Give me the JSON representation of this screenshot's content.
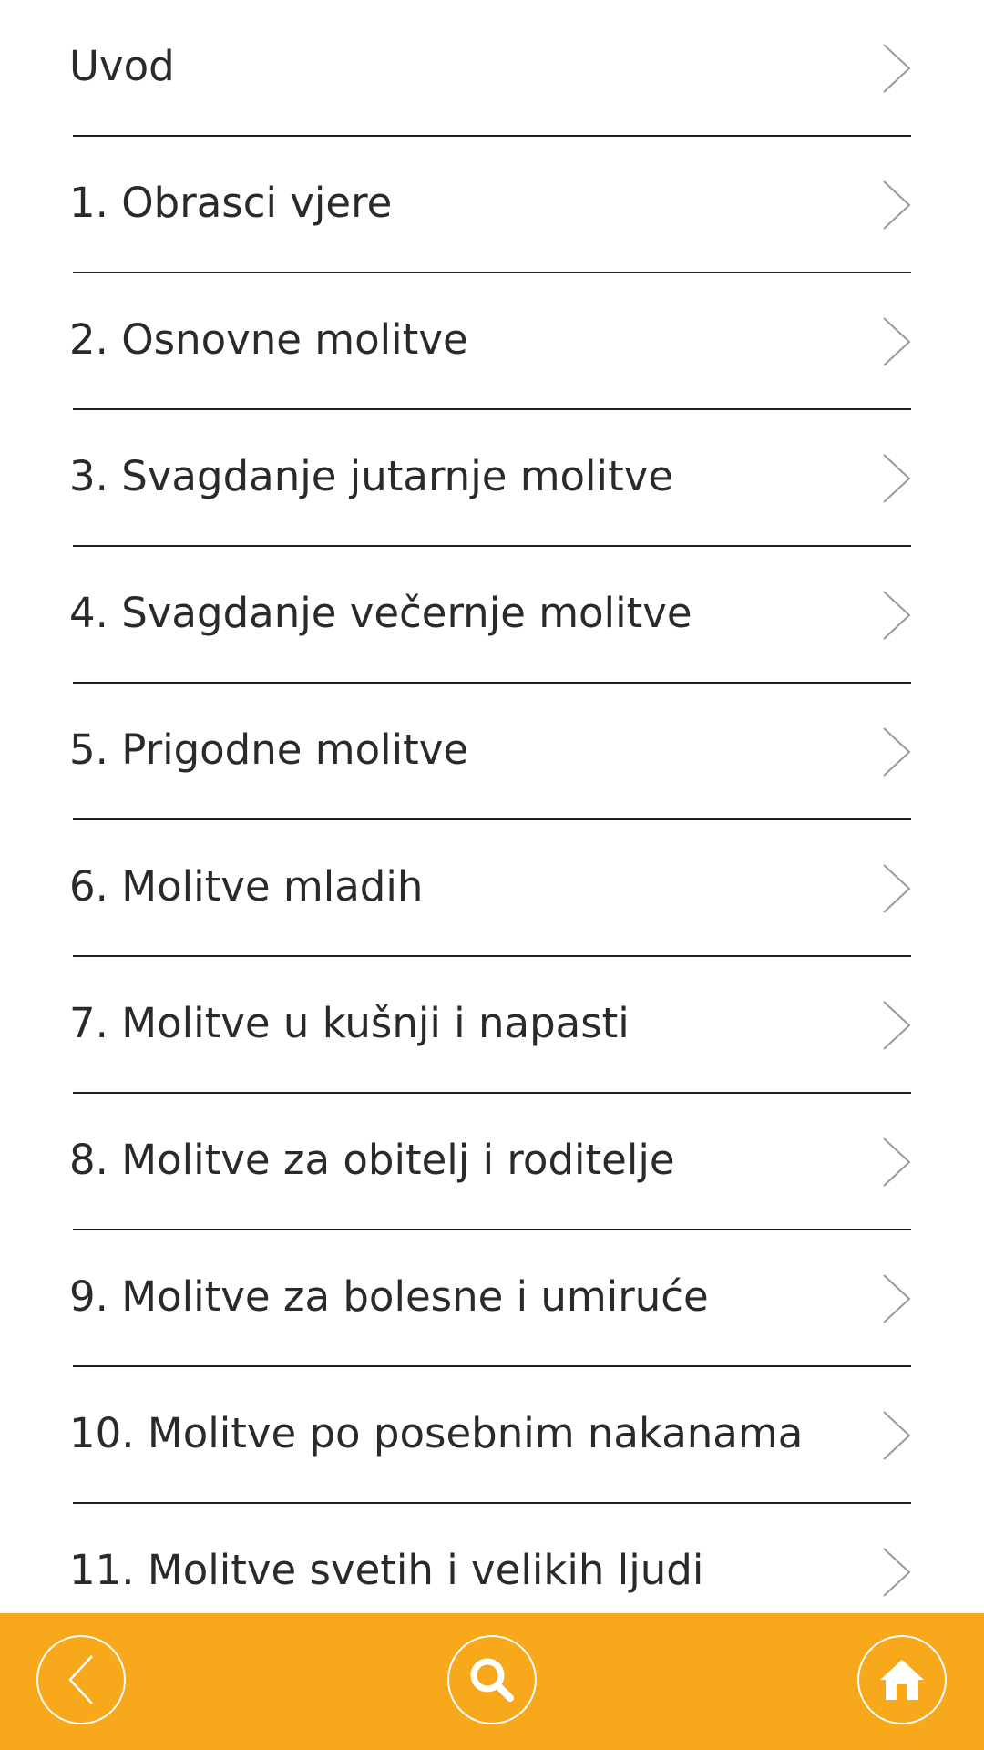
{
  "menu": {
    "items": [
      {
        "label": "Uvod"
      },
      {
        "label": "1. Obrasci vjere"
      },
      {
        "label": "2. Osnovne molitve"
      },
      {
        "label": "3. Svagdanje jutarnje molitve"
      },
      {
        "label": "4. Svagdanje večernje molitve"
      },
      {
        "label": "5. Prigodne molitve"
      },
      {
        "label": "6. Molitve mladih"
      },
      {
        "label": "7. Molitve u kušnji i napasti"
      },
      {
        "label": "8. Molitve za obitelj i roditelje"
      },
      {
        "label": "9. Molitve za bolesne i umiruće"
      },
      {
        "label": "10. Molitve po posebnim nakanama"
      },
      {
        "label": "11. Molitve svetih i velikih ljudi"
      }
    ]
  },
  "bottom_bar": {
    "accent_color": "#f7a81b",
    "buttons": [
      {
        "icon": "back-arrow-icon"
      },
      {
        "icon": "search-icon"
      },
      {
        "icon": "home-icon"
      }
    ]
  }
}
